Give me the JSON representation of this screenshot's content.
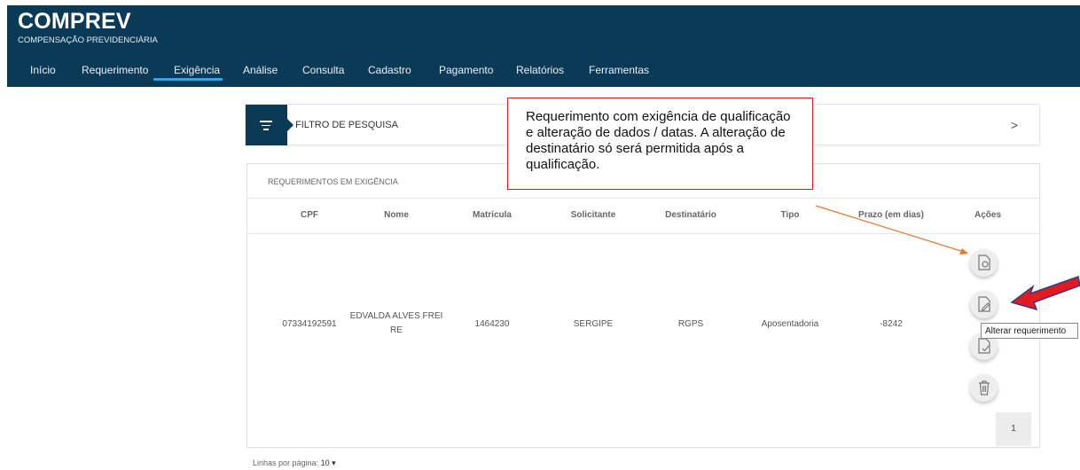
{
  "header": {
    "title": "COMPREV",
    "subtitle": "COMPENSAÇÃO PREVIDENCIÁRIA",
    "nav": [
      {
        "label": "Início"
      },
      {
        "label": "Requerimento"
      },
      {
        "label": "Exigência",
        "active": true
      },
      {
        "label": "Análise"
      },
      {
        "label": "Consulta"
      },
      {
        "label": "Cadastro"
      },
      {
        "label": "Pagamento"
      },
      {
        "label": "Relatórios"
      },
      {
        "label": "Ferramentas"
      }
    ],
    "color": "#0b3a57",
    "accent": "#2fa4e7"
  },
  "filter": {
    "label": "FILTRO DE PESQUISA",
    "icon": "filter-icon",
    "expand_icon": "chevron-right-icon",
    "expand_symbol": ">"
  },
  "table": {
    "heading": "REQUERIMENTOS EM EXIGÊNCIA",
    "columns": [
      "CPF",
      "Nome",
      "Matrícula",
      "Solicitante",
      "Destinatário",
      "Tipo",
      "Prazo (em dias)",
      "Ações"
    ],
    "rows": [
      {
        "cpf": "07334192591",
        "nome_line1": "EDVALDA ALVES FREI",
        "nome_line2": "RE",
        "matricula": "1464230",
        "solicitante": "SERGIPE",
        "destinatario": "RGPS",
        "tipo": "Aposentadoria",
        "prazo": "-8242"
      }
    ],
    "actions": [
      "view-document-icon",
      "edit-document-icon",
      "approve-document-icon",
      "trash-icon"
    ]
  },
  "pagination": {
    "page": "1",
    "rows_per_page_label": "Linhas por página:",
    "rows_per_page_value": "10 ▾"
  },
  "annotation": {
    "callout_text": "Requerimento com exigência de qualificação e alteração de dados / datas. A alteração de destinatário só será permitida após a qualificação.",
    "tooltip": "Alterar requerimento",
    "arrow_color": "#e8782a",
    "pointer_color": "#e11b22"
  }
}
